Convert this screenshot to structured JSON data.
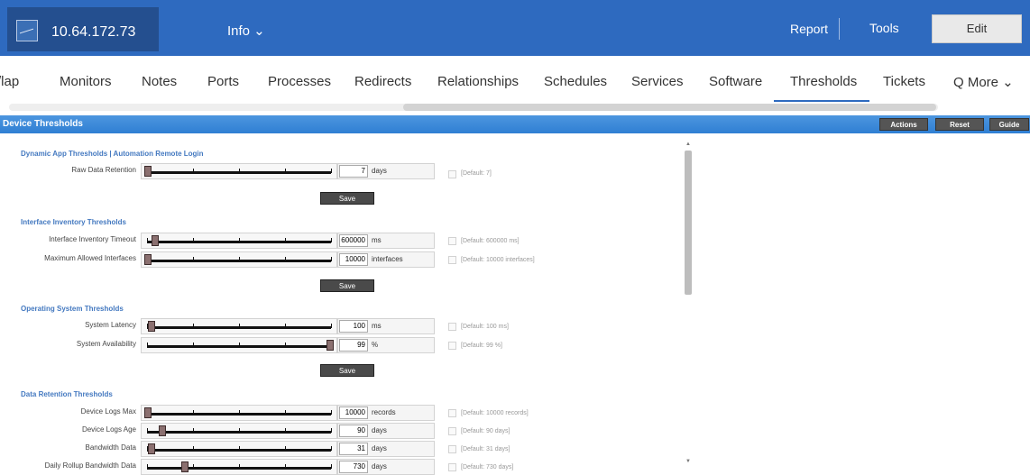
{
  "header": {
    "device_name": "10.64.172.73",
    "info_menu": "Info ⌄",
    "report": "Report",
    "tools": "Tools",
    "edit": "Edit"
  },
  "tabs": [
    {
      "label": "/lap",
      "active": false
    },
    {
      "label": "Monitors",
      "active": false
    },
    {
      "label": "Notes",
      "active": false
    },
    {
      "label": "Ports",
      "active": false
    },
    {
      "label": "Processes",
      "active": false
    },
    {
      "label": "Redirects",
      "active": false
    },
    {
      "label": "Relationships",
      "active": false
    },
    {
      "label": "Schedules",
      "active": false
    },
    {
      "label": "Services",
      "active": false
    },
    {
      "label": "Software",
      "active": false
    },
    {
      "label": "Thresholds",
      "active": true
    },
    {
      "label": "Tickets",
      "active": false
    }
  ],
  "more_label": "Q More ⌄",
  "section": {
    "title": "Device Thresholds",
    "actions": "Actions",
    "reset": "Reset",
    "guide": "Guide"
  },
  "groups": [
    {
      "title": "Dynamic App Thresholds | Automation Remote Login",
      "save": "Save",
      "rows": [
        {
          "label": "Raw Data Retention",
          "value": "7",
          "unit": "days",
          "default": "[Default: 7]",
          "level": 0.0
        }
      ]
    },
    {
      "title": "Interface Inventory Thresholds",
      "save": "Save",
      "rows": [
        {
          "label": "Interface Inventory Timeout",
          "value": "600000",
          "unit": "ms",
          "default": "[Default: 600000 ms]",
          "level": 0.04
        },
        {
          "label": "Maximum Allowed Interfaces",
          "value": "10000",
          "unit": "interfaces",
          "default": "[Default: 10000 interfaces]",
          "level": 0.0
        }
      ]
    },
    {
      "title": "Operating System Thresholds",
      "save": "Save",
      "rows": [
        {
          "label": "System Latency",
          "value": "100",
          "unit": "ms",
          "default": "[Default: 100 ms]",
          "level": 0.02
        },
        {
          "label": "System Availability",
          "value": "99",
          "unit": "%",
          "default": "[Default: 99 %]",
          "level": 0.99
        }
      ]
    },
    {
      "title": "Data Retention Thresholds",
      "rows": [
        {
          "label": "Device Logs Max",
          "value": "10000",
          "unit": "records",
          "default": "[Default: 10000 records]",
          "level": 0.0
        },
        {
          "label": "Device Logs Age",
          "value": "90",
          "unit": "days",
          "default": "[Default: 90 days]",
          "level": 0.08
        },
        {
          "label": "Bandwidth Data",
          "value": "31",
          "unit": "days",
          "default": "[Default: 31 days]",
          "level": 0.02
        },
        {
          "label": "Daily Rollup Bandwidth Data",
          "value": "730",
          "unit": "days",
          "default": "[Default: 730 days]",
          "level": 0.2
        }
      ]
    }
  ],
  "colors": {
    "brand": "#2e6abf",
    "section_header": "#3a89d9",
    "group_title": "#4479c0"
  }
}
